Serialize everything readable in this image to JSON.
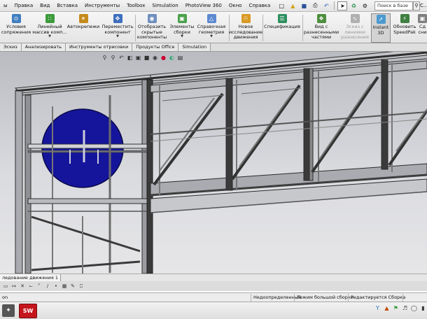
{
  "menubar": {
    "items": [
      "ы",
      "Правка",
      "Вид",
      "Вставка",
      "Инструменты",
      "Toolbox",
      "Simulation",
      "PhotoView 360",
      "Окно",
      "Справка"
    ],
    "quick_access": [
      "new-document-icon",
      "open-folder-icon",
      "save-icon",
      "print-icon",
      "undo-icon",
      "select-arrow-icon",
      "rebuild-icon",
      "options-icon"
    ],
    "search_placeholder": "Поиск в базе",
    "overflow": "С..."
  },
  "ribbon": {
    "buttons": [
      {
        "label1": "Условия",
        "label2": "сопряжения",
        "icon": "mate-icon",
        "color": "#3f7fbf"
      },
      {
        "label1": "Линейный",
        "label2": "массив комп...",
        "icon": "linear-pattern-icon",
        "color": "#3d9b3d"
      },
      {
        "label1": "Автокрепежи",
        "label2": "",
        "icon": "smart-fasteners-icon",
        "color": "#c58a1b"
      },
      {
        "label1": "Переместить",
        "label2": "компонент",
        "icon": "move-component-icon",
        "color": "#3f6fbf"
      },
      {
        "label1": "Отобразить",
        "label2": "скрытые",
        "label3": "компоненты",
        "icon": "show-hidden-icon",
        "color": "#6f8fbf"
      },
      {
        "label1": "Элементы",
        "label2": "сборки",
        "icon": "assembly-features-icon",
        "color": "#4aa04a"
      },
      {
        "label1": "Справочная",
        "label2": "геометрия",
        "icon": "reference-geometry-icon",
        "color": "#5c8ad0"
      },
      {
        "label1": "Новое",
        "label2": "исследование",
        "label3": "движения",
        "icon": "motion-study-icon",
        "color": "#d89a22"
      },
      {
        "label1": "Спецификация",
        "label2": "",
        "icon": "bom-icon",
        "color": "#2f8f5f"
      },
      {
        "label1": "Вид с",
        "label2": "разнесенными",
        "label3": "частями",
        "icon": "exploded-view-icon",
        "color": "#4f8f3f"
      },
      {
        "label1": "Эскиз с",
        "label2": "линиями",
        "label3": "разнесения",
        "icon": "explode-line-sketch-icon",
        "color": "#9a9a9a"
      },
      {
        "label1": "Instant",
        "label2": "3D",
        "icon": "instant-3d-icon",
        "color": "#4a9ad0"
      },
      {
        "label1": "Обновить",
        "label2": "SpeedPak",
        "icon": "speedpak-icon",
        "color": "#3f7f3f"
      },
      {
        "label1": "Сд",
        "label2": "сни",
        "icon": "snapshot-icon",
        "color": "#7f7f7f"
      }
    ]
  },
  "tabs": [
    "Эскиз",
    "Анализировать",
    "Инструменты отрисовки",
    "Продукты Office",
    "Simulation"
  ],
  "viewport": {
    "heads_up_toolbar": [
      "zoom-fit-icon",
      "zoom-area-icon",
      "previous-view-icon",
      "section-view-icon",
      "view-orientation-icon",
      "display-style-icon",
      "hide-show-icon",
      "edit-appearance-icon",
      "scene-icon",
      "display-settings-icon"
    ],
    "sign_color": "#15159c"
  },
  "motion_bar": {
    "tab": "ледование движения 1"
  },
  "sketch_tools": [
    "rectangle-tool-icon",
    "smart-dimension-icon",
    "trim-tool-icon",
    "corner-rectangle-icon",
    "mirror-tool-icon",
    "line-tool-icon",
    "point-icon",
    "grid-icon",
    "sketch-icon",
    "display-icon"
  ],
  "statusbar": {
    "left": "on",
    "underdefined": "Недоопределенный",
    "large_assembly": "Режим большой сборки",
    "editing": "Редактируется Сборка"
  },
  "taskbar": {
    "app_label": "SW",
    "tray": [
      "yammer-icon",
      "network-icon",
      "flag-icon",
      "volume-icon",
      "power-icon",
      "battery-icon"
    ]
  },
  "colors": {
    "frame_dark": "#343434",
    "frame_light": "#a8aab0",
    "sign_blue": "#15159c",
    "background_top": "#b9bbc1"
  }
}
